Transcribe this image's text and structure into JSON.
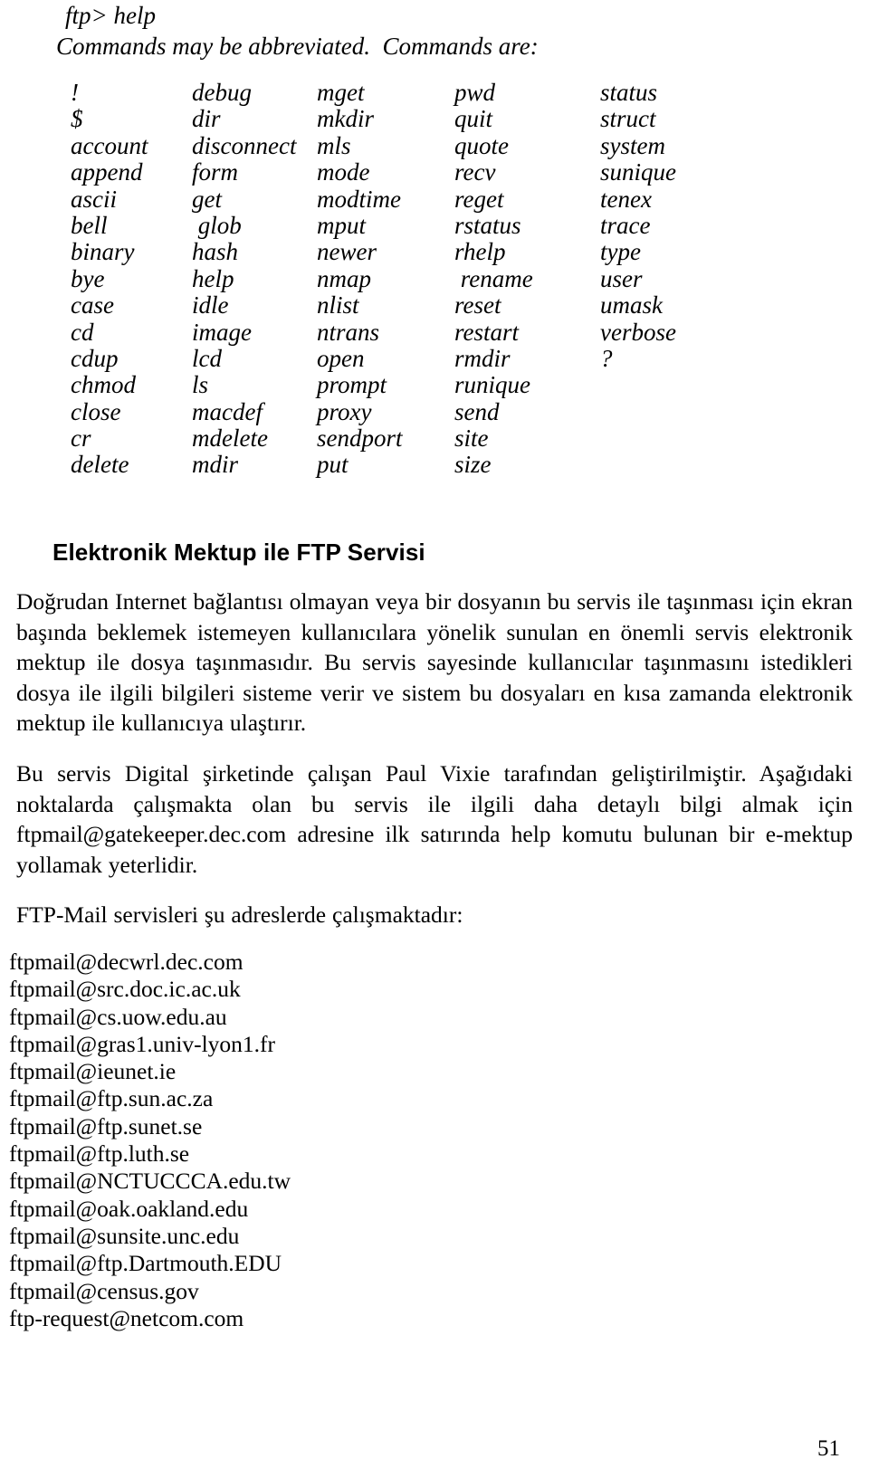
{
  "document": {
    "page_number": "51"
  },
  "transcript": {
    "prompt_line": "ftp> help",
    "info_line": "Commands may be abbreviated.  Commands are:"
  },
  "command_grid": {
    "rows": [
      [
        "!",
        "debug",
        "mget",
        "pwd",
        "status"
      ],
      [
        "$",
        "dir",
        "mkdir",
        "quit",
        "struct"
      ],
      [
        "account",
        "disconnect",
        "mls",
        "quote",
        "system"
      ],
      [
        "append",
        "form",
        "mode",
        "recv",
        "sunique"
      ],
      [
        "ascii",
        "get",
        "modtime",
        "reget",
        "tenex"
      ],
      [
        "bell",
        " glob",
        "mput",
        "rstatus",
        "trace"
      ],
      [
        "binary",
        "hash",
        "newer",
        "rhelp",
        "type"
      ],
      [
        "bye",
        "help",
        "nmap",
        " rename",
        "user"
      ],
      [
        "case",
        "idle",
        "nlist",
        "reset",
        "umask"
      ],
      [
        "cd",
        "image",
        "ntrans",
        "restart",
        "verbose"
      ],
      [
        "cdup",
        "lcd",
        "open",
        "rmdir",
        "?"
      ],
      [
        "chmod",
        "ls",
        "prompt",
        "runique",
        ""
      ],
      [
        "close",
        "macdef",
        "proxy",
        "send",
        ""
      ],
      [
        "cr",
        "mdelete",
        "sendport",
        "site",
        ""
      ],
      [
        "delete",
        "mdir",
        "put",
        "size",
        ""
      ]
    ]
  },
  "section": {
    "heading": "Elektronik Mektup ile FTP Servisi",
    "paragraphs": [
      "Doğrudan Internet bağlantısı olmayan veya bir dosyanın bu servis ile taşınması için ekran başında  beklemek  istemeyen kullanıcılara yönelik sunulan en önemli  servis elektronik  mektup ile dosya taşınmasıdır.  Bu servis  sayesinde kullanıcılar  taşınmasını istedikleri dosya ile ilgili bilgileri sisteme verir  ve sistem bu dosyaları  en kısa zamanda elektronik mektup ile  kullanıcıya ulaştırır.",
      "Bu servis Digital  şirketinde çalışan Paul Vixie  tarafından geliştirilmiştir.  Aşağıdaki noktalarda  çalışmakta  olan  bu  servis  ile  ilgili   daha  detaylı  bilgi  almak  için ftpmail@gatekeeper.dec.com  adresine  ilk satırında  help  komutu bulunan bir e-mektup yollamak yeterlidir.",
      "FTP-Mail servisleri  şu adreslerde çalışmaktadır:"
    ]
  },
  "addresses": [
    "ftpmail@decwrl.dec.com",
    "ftpmail@src.doc.ic.ac.uk",
    "ftpmail@cs.uow.edu.au",
    "ftpmail@gras1.univ-lyon1.fr",
    "ftpmail@ieunet.ie",
    "ftpmail@ftp.sun.ac.za",
    "ftpmail@ftp.sunet.se",
    "ftpmail@ftp.luth.se",
    "ftpmail@NCTUCCCA.edu.tw",
    "ftpmail@oak.oakland.edu",
    "ftpmail@sunsite.unc.edu",
    "ftpmail@ftp.Dartmouth.EDU",
    "ftpmail@census.gov",
    "ftp-request@netcom.com"
  ]
}
